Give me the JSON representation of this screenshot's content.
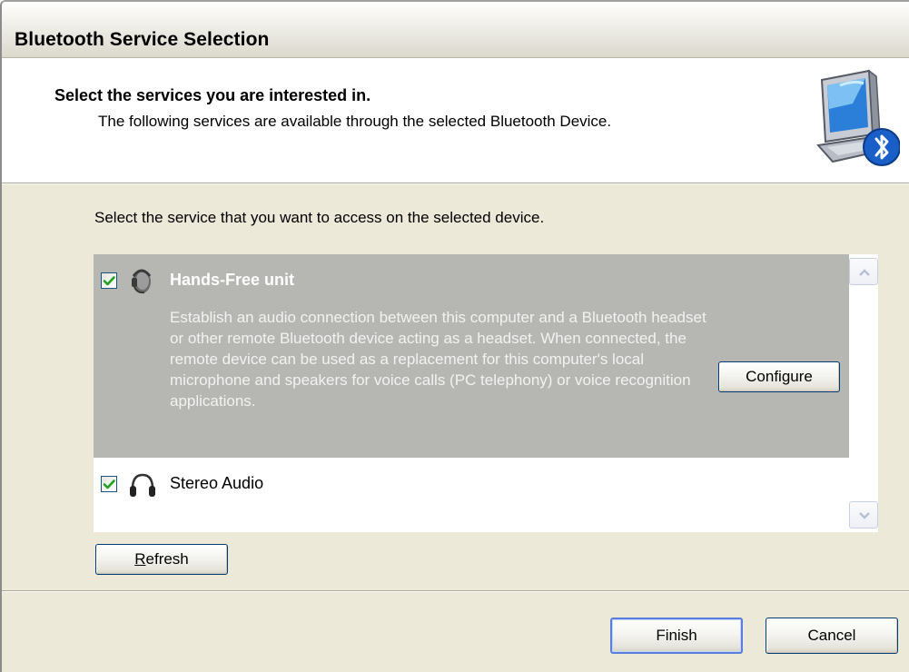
{
  "window": {
    "title": "Bluetooth Service Selection"
  },
  "header": {
    "title": "Select the services you are interested in.",
    "subtitle": "The following services are available through the selected Bluetooth Device."
  },
  "instruction": "Select the service that you want to access on the selected device.",
  "services": [
    {
      "name": "Hands-Free unit",
      "checked": true,
      "icon": "headset-icon",
      "description": "Establish an audio connection between this computer and a Bluetooth headset or other remote Bluetooth device acting as a headset. When connected, the remote device can be used as a replacement for this computer's local microphone and speakers for voice calls (PC telephony) or voice recognition applications.",
      "configure_label": "Configure"
    },
    {
      "name": "Stereo Audio",
      "checked": true,
      "icon": "headphones-icon"
    }
  ],
  "buttons": {
    "refresh_first": "R",
    "refresh_rest": "efresh",
    "finish": "Finish",
    "cancel": "Cancel"
  },
  "colors": {
    "dialog_bg": "#ece9d8",
    "selected_row": "#b6b6b2",
    "button_border": "#003c74",
    "checkmark": "#21a121",
    "bluetooth_blue": "#1a5fc7"
  }
}
